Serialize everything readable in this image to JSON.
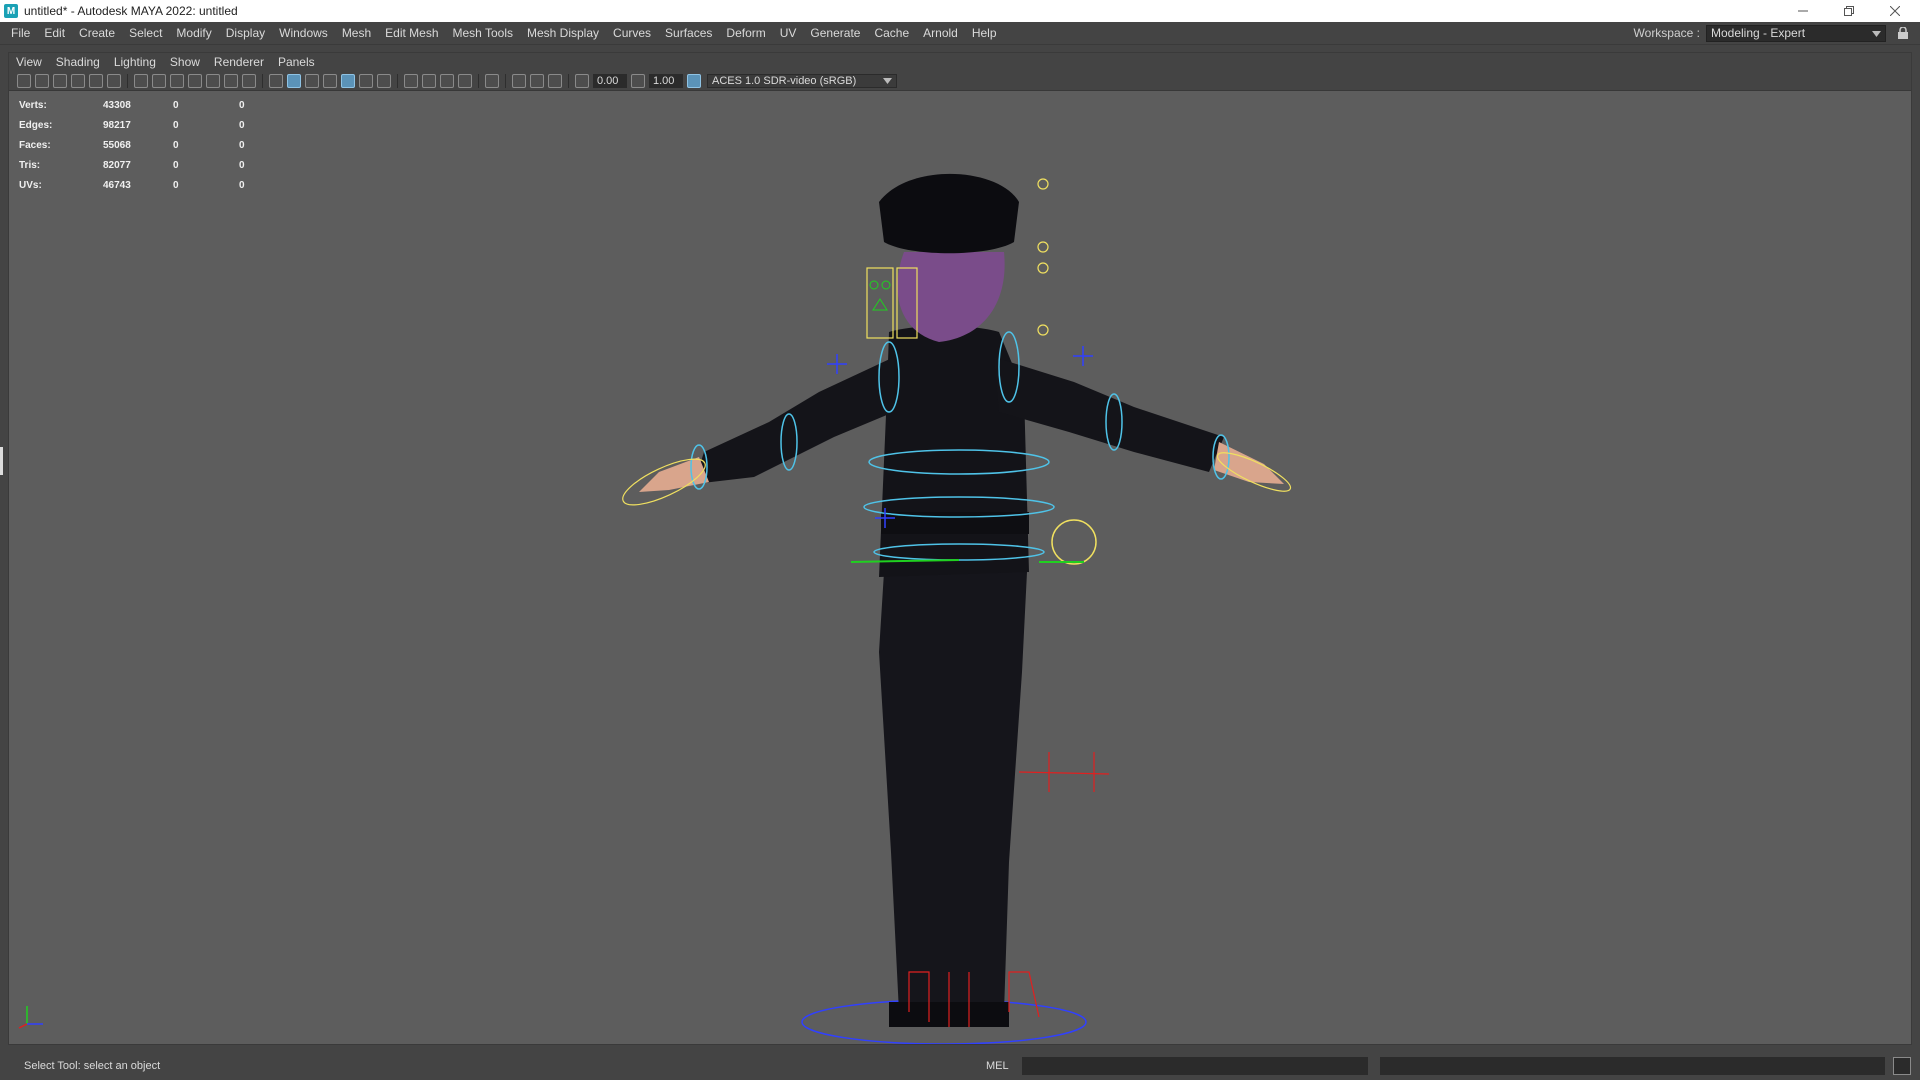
{
  "window": {
    "title": "untitled* - Autodesk MAYA 2022: untitled",
    "app_icon": "M",
    "controls": [
      "minimize-icon",
      "restore-icon",
      "close-icon"
    ]
  },
  "main_menu": [
    "File",
    "Edit",
    "Create",
    "Select",
    "Modify",
    "Display",
    "Windows",
    "Mesh",
    "Edit Mesh",
    "Mesh Tools",
    "Mesh Display",
    "Curves",
    "Surfaces",
    "Deform",
    "UV",
    "Generate",
    "Cache",
    "Arnold",
    "Help"
  ],
  "workspace": {
    "label": "Workspace :",
    "value": "Modeling - Expert"
  },
  "panel_menu": [
    "View",
    "Shading",
    "Lighting",
    "Show",
    "Renderer",
    "Panels"
  ],
  "toolbar": {
    "exposure": "0.00",
    "gamma": "1.00",
    "color_space": "ACES 1.0 SDR-video (sRGB)"
  },
  "hud": {
    "rows": [
      {
        "label": "Verts:",
        "value": "43308",
        "sel": "0",
        "comp": "0"
      },
      {
        "label": "Edges:",
        "value": "98217",
        "sel": "0",
        "comp": "0"
      },
      {
        "label": "Faces:",
        "value": "55068",
        "sel": "0",
        "comp": "0"
      },
      {
        "label": "Tris:",
        "value": "82077",
        "sel": "0",
        "comp": "0"
      },
      {
        "label": "UVs:",
        "value": "46743",
        "sel": "0",
        "comp": "0"
      }
    ]
  },
  "viewport": {
    "camera": "persp"
  },
  "status": {
    "help_line": "Select Tool: select an object",
    "command_language": "MEL"
  },
  "colors": {
    "viewport_bg": "#5d5d5d",
    "ui_bg": "#444444",
    "rig_cyan": "#4fc3e8",
    "rig_yellow": "#f0e060",
    "rig_red": "#e02020",
    "rig_green": "#20d020",
    "rig_blue": "#3040ff"
  }
}
